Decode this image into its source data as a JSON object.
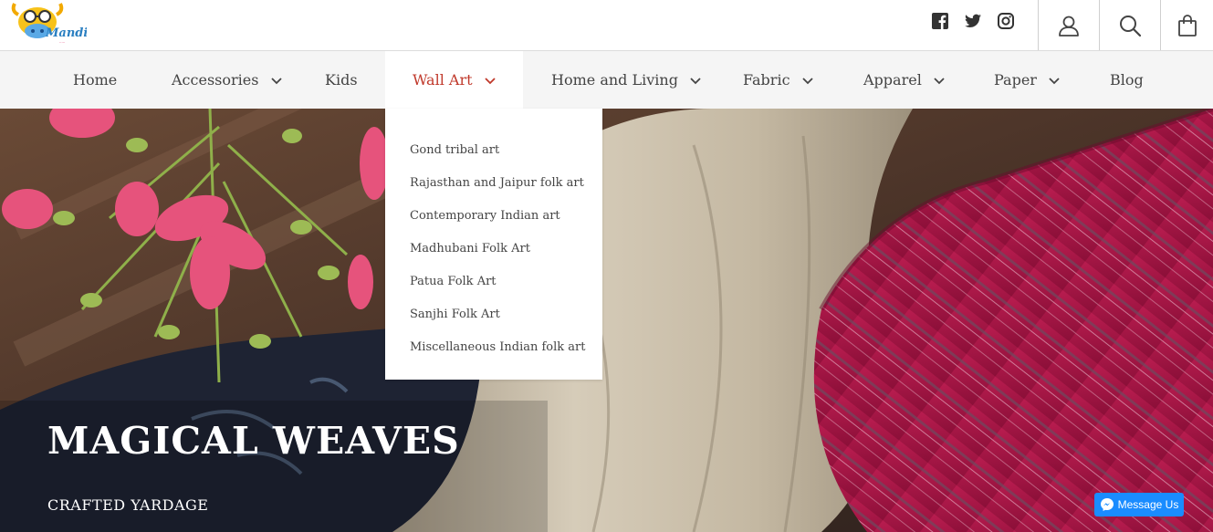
{
  "header": {
    "social": [
      {
        "name": "facebook-icon"
      },
      {
        "name": "twitter-icon"
      },
      {
        "name": "instagram-icon"
      }
    ],
    "actions": [
      {
        "name": "account-icon"
      },
      {
        "name": "search-icon"
      },
      {
        "name": "cart-icon"
      }
    ]
  },
  "nav": {
    "items": [
      {
        "label": "Home",
        "dropdown": false
      },
      {
        "label": "Accessories",
        "dropdown": true
      },
      {
        "label": "Kids",
        "dropdown": false
      },
      {
        "label": "Wall Art",
        "dropdown": true,
        "active": true
      },
      {
        "label": "Home and Living",
        "dropdown": true
      },
      {
        "label": "Fabric",
        "dropdown": true
      },
      {
        "label": "Apparel",
        "dropdown": true
      },
      {
        "label": "Paper",
        "dropdown": true
      },
      {
        "label": "Blog",
        "dropdown": false
      }
    ],
    "active_color": "#c0392b"
  },
  "dropdown": {
    "items": [
      "Gond tribal art",
      "Rajasthan and Jaipur folk art",
      "Contemporary Indian art",
      "Madhubani Folk Art",
      "Patua Folk Art",
      "Sanjhi Folk Art",
      "Miscellaneous Indian folk art"
    ]
  },
  "hero": {
    "title": "MAGICAL WEAVES",
    "subtitle": "CRAFTED YARDAGE"
  },
  "messenger": {
    "label": "Message Us",
    "color": "#1a8cff"
  }
}
